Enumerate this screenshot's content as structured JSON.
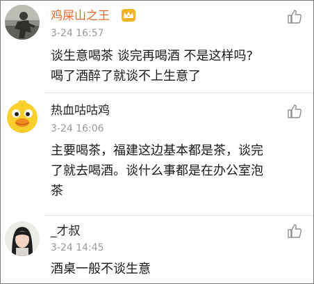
{
  "comments": [
    {
      "username": "鸡屎山之王",
      "timestamp": "3-24 16:57",
      "lines": [
        "谈生意喝茶  谈完再喝酒  不是这样吗?",
        "喝了酒醉了就谈不上生意了"
      ],
      "avatar_icon": "man-photo-avatar",
      "badge_icon": "vip-crown-icon",
      "username_color": "#e8692d"
    },
    {
      "username": "热血咕咕鸡",
      "timestamp": "3-24 16:06",
      "lines": [
        "主要喝茶，福建这边基本都是茶，谈完",
        "了就去喝酒。谈什么事都是在办公室泡",
        "茶"
      ],
      "avatar_icon": "yellow-chick-avatar"
    },
    {
      "username": "_才叔",
      "timestamp": "3-24 14:45",
      "lines": [
        "酒桌一般不谈生意"
      ],
      "avatar_icon": "girl-photo-avatar"
    }
  ],
  "like_icon": "thumbs-up-icon"
}
